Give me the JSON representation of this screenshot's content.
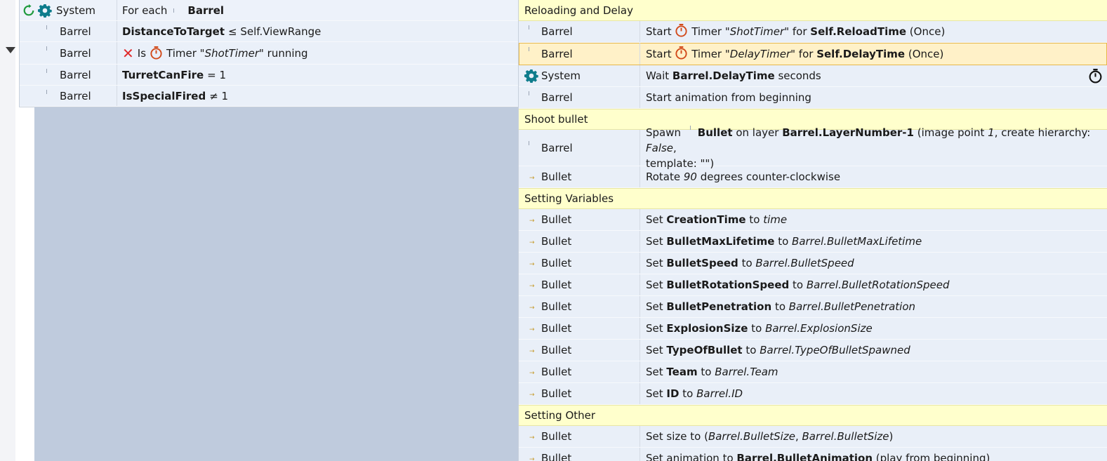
{
  "event": {
    "conditions": [
      {
        "object": "System",
        "prefix": "For each",
        "bold": "Barrel",
        "rest": ""
      },
      {
        "object": "Barrel",
        "bold": "DistanceToTarget",
        "rest": "≤ Self.ViewRange"
      },
      {
        "object": "Barrel",
        "pre1": "Is",
        "pre2": "Timer \"",
        "italic": "ShotTimer",
        "rest": "\" running"
      },
      {
        "object": "Barrel",
        "bold": "TurretCanFire",
        "rest": "= 1"
      },
      {
        "object": "Barrel",
        "bold": "IsSpecialFired",
        "rest": "≠ 1"
      }
    ]
  },
  "actions": {
    "comments": {
      "reload": "Reloading and Delay",
      "shoot": "Shoot bullet",
      "vars": "Setting Variables",
      "other": "Setting Other"
    },
    "reload": [
      {
        "object": "Barrel",
        "t1": "Start",
        "t2": "Timer \"",
        "it": "ShotTimer",
        "t3": "\" for",
        "b": "Self.ReloadTime",
        "t4": "(Once)"
      },
      {
        "object": "Barrel",
        "t1": "Start",
        "t2": "Timer \"",
        "it": "DelayTimer",
        "t3": "\" for",
        "b": "Self.DelayTime",
        "t4": "(Once)"
      },
      {
        "object": "System",
        "t1": "Wait",
        "b": "Barrel.DelayTime",
        "t4": "seconds"
      },
      {
        "object": "Barrel",
        "t1": "Start animation from beginning"
      }
    ],
    "shoot": [
      {
        "object": "Barrel",
        "t1": "Spawn",
        "b1": "Bullet",
        "t2": "on layer",
        "b2": "Barrel.LayerNumber-1",
        "t3": "(image point",
        "i1": "1",
        "t4": ", create hierarchy:",
        "i2": "False",
        "t5": ",",
        "t6": "template: \"\")"
      },
      {
        "object": "Bullet",
        "t1": "Rotate",
        "i1": "90",
        "t2": "degrees counter-clockwise"
      }
    ],
    "vars": [
      {
        "object": "Bullet",
        "label": "Set",
        "name": "CreationTime",
        "to": "to",
        "value": "time"
      },
      {
        "object": "Bullet",
        "label": "Set",
        "name": "BulletMaxLifetime",
        "to": "to",
        "value": "Barrel.BulletMaxLifetime"
      },
      {
        "object": "Bullet",
        "label": "Set",
        "name": "BulletSpeed",
        "to": "to",
        "value": "Barrel.BulletSpeed"
      },
      {
        "object": "Bullet",
        "label": "Set",
        "name": "BulletRotationSpeed",
        "to": "to",
        "value": "Barrel.BulletRotationSpeed"
      },
      {
        "object": "Bullet",
        "label": "Set",
        "name": "BulletPenetration",
        "to": "to",
        "value": "Barrel.BulletPenetration"
      },
      {
        "object": "Bullet",
        "label": "Set",
        "name": "ExplosionSize",
        "to": "to",
        "value": "Barrel.ExplosionSize"
      },
      {
        "object": "Bullet",
        "label": "Set",
        "name": "TypeOfBullet",
        "to": "to",
        "value": "Barrel.TypeOfBulletSpawned"
      },
      {
        "object": "Bullet",
        "label": "Set",
        "name": "Team",
        "to": "to",
        "value": "Barrel.Team"
      },
      {
        "object": "Bullet",
        "label": "Set",
        "name": "ID",
        "to": "to",
        "value": "Barrel.ID"
      }
    ],
    "other": [
      {
        "object": "Bullet",
        "t1": "Set size to (",
        "i1": "Barrel.BulletSize",
        "t2": ",",
        "i2": "Barrel.BulletSize",
        "t3": ")"
      },
      {
        "object": "Bullet",
        "t1": "Set animation to",
        "b": "Barrel.BulletAnimation",
        "t2": "(play from beginning)"
      }
    ]
  },
  "colors": {
    "comment_bg": "#ffffcc",
    "row_bg": "#e9eff8",
    "selected_bg": "#fff1c8",
    "event_body": "#bfcbdd",
    "gear": "#0e7c8c",
    "timer": "#d24a1a",
    "invert_x": "#e02a2a",
    "repeat_icon": "#1f9a3d"
  },
  "icons": [
    "repeat-icon",
    "gear-icon",
    "timer-icon",
    "invert-x-icon",
    "collapse-arrow-icon"
  ]
}
